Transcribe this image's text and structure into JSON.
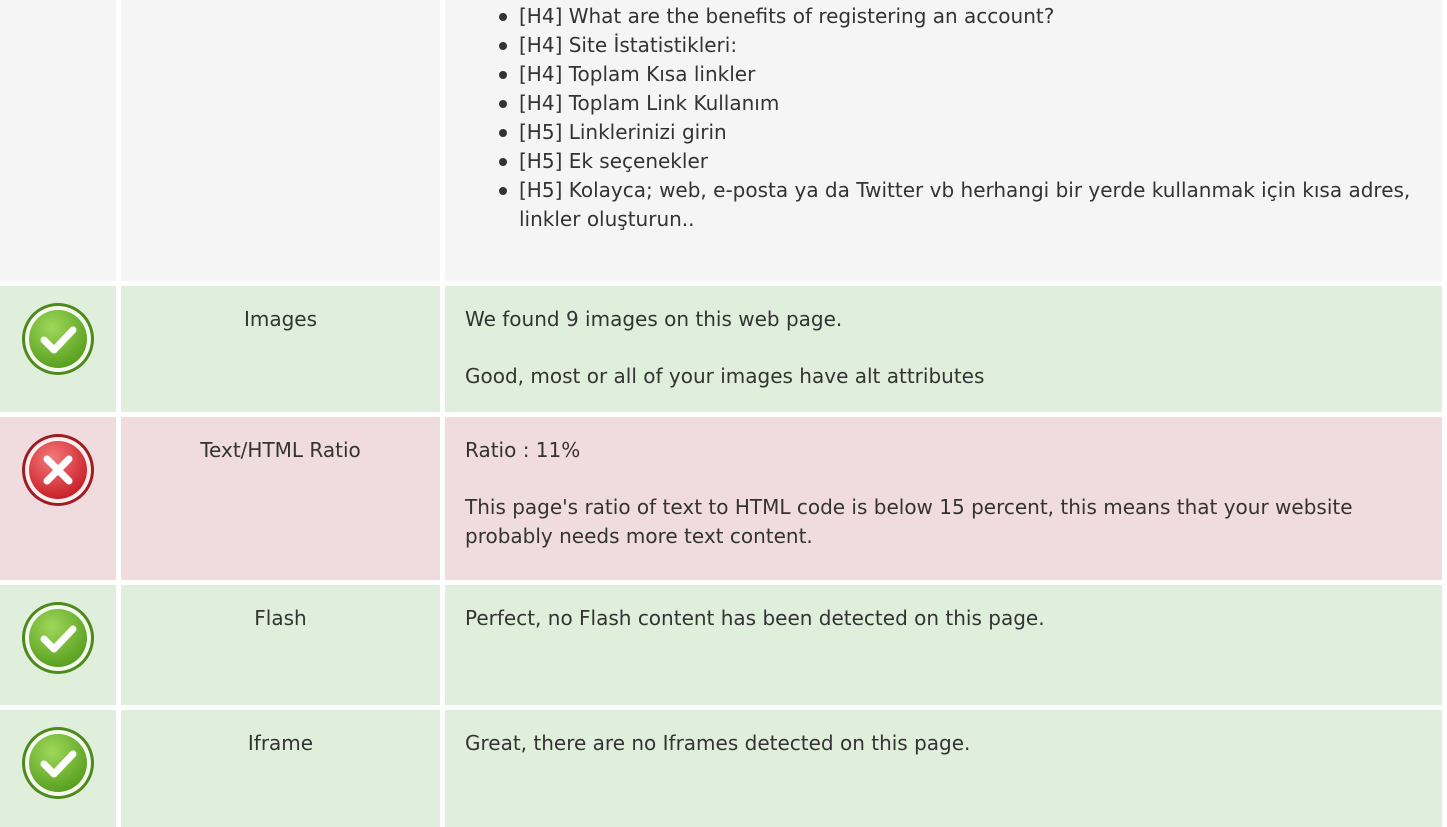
{
  "headings_row": {
    "items": [
      "[H4] What are the benefits of registering an account?",
      "[H4] Site İstatistikleri:",
      "[H4] Toplam Kısa linkler",
      "[H4] Toplam Link Kullanım",
      "[H5] Linklerinizi girin",
      "[H5] Ek seçenekler",
      "[H5] Kolayca; web, e-posta ya da Twitter vb herhangi bir yerde kullanmak için kısa adres, linkler oluşturun.."
    ]
  },
  "checks": [
    {
      "status": "pass",
      "icon": "check-icon",
      "label": "Images",
      "lines": [
        "We found 9 images on this web page.",
        "Good, most or all of your images have alt attributes"
      ]
    },
    {
      "status": "fail",
      "icon": "cross-icon",
      "label": "Text/HTML Ratio",
      "lines": [
        "Ratio : 11%",
        "This page's ratio of text to HTML code is below 15 percent, this means that your website probably needs more text content."
      ]
    },
    {
      "status": "pass",
      "icon": "check-icon",
      "label": "Flash",
      "lines": [
        "Perfect, no Flash content has been detected on this page."
      ]
    },
    {
      "status": "pass",
      "icon": "check-icon",
      "label": "Iframe",
      "lines": [
        "Great, there are no Iframes detected on this page."
      ]
    }
  ],
  "colors": {
    "pass_bg": "#e0efdc",
    "fail_bg": "#f0dcdf",
    "neutral_bg": "#f5f5f5",
    "pass_icon": "#6fb52c",
    "fail_icon": "#d9363e"
  }
}
